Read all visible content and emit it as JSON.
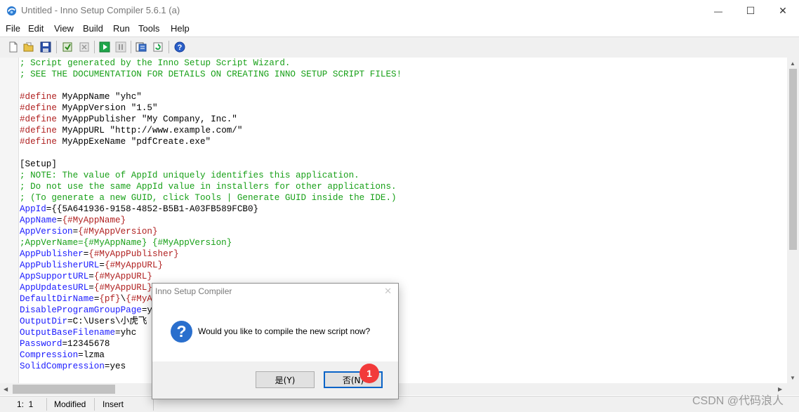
{
  "window": {
    "title": "Untitled - Inno Setup Compiler 5.6.1 (a)",
    "minimize_glyph": "—",
    "maximize_glyph": "☐",
    "close_glyph": "✕"
  },
  "menu": {
    "file": "File",
    "edit": "Edit",
    "view": "View",
    "build": "Build",
    "run": "Run",
    "tools": "Tools",
    "help": "Help"
  },
  "toolbar": {
    "icons": [
      "new-file-icon",
      "open-folder-icon",
      "save-icon",
      "compile-icon",
      "stop-compile-icon",
      "run-icon",
      "pause-icon",
      "target-icon",
      "refresh-icon",
      "help-icon"
    ]
  },
  "editor": {
    "lines": [
      {
        "segments": [
          {
            "text": "; Script generated by the Inno Setup Script Wizard.",
            "cls": "c-comment"
          }
        ]
      },
      {
        "segments": [
          {
            "text": "; SEE THE DOCUMENTATION FOR DETAILS ON CREATING INNO SETUP SCRIPT FILES!",
            "cls": "c-comment"
          }
        ]
      },
      {
        "segments": []
      },
      {
        "segments": [
          {
            "text": "#define",
            "cls": "c-define"
          },
          {
            "text": " MyAppName \"yhc\"",
            "cls": ""
          }
        ]
      },
      {
        "segments": [
          {
            "text": "#define",
            "cls": "c-define"
          },
          {
            "text": " MyAppVersion \"1.5\"",
            "cls": ""
          }
        ]
      },
      {
        "segments": [
          {
            "text": "#define",
            "cls": "c-define"
          },
          {
            "text": " MyAppPublisher \"My Company, Inc.\"",
            "cls": ""
          }
        ]
      },
      {
        "segments": [
          {
            "text": "#define",
            "cls": "c-define"
          },
          {
            "text": " MyAppURL \"http://www.example.com/\"",
            "cls": ""
          }
        ]
      },
      {
        "segments": [
          {
            "text": "#define",
            "cls": "c-define"
          },
          {
            "text": " MyAppExeName \"pdfCreate.exe\"",
            "cls": ""
          }
        ]
      },
      {
        "segments": []
      },
      {
        "segments": [
          {
            "text": "[Setup]",
            "cls": ""
          }
        ]
      },
      {
        "segments": [
          {
            "text": "; NOTE: The value of AppId uniquely identifies this application.",
            "cls": "c-comment"
          }
        ]
      },
      {
        "segments": [
          {
            "text": "; Do not use the same AppId value in installers for other applications.",
            "cls": "c-comment"
          }
        ]
      },
      {
        "segments": [
          {
            "text": "; (To generate a new GUID, click Tools | Generate GUID inside the IDE.)",
            "cls": "c-comment"
          }
        ]
      },
      {
        "segments": [
          {
            "text": "AppId",
            "cls": "c-key"
          },
          {
            "text": "={{5A641936-9158-4852-B5B1-A03FB589FCB0}",
            "cls": ""
          }
        ]
      },
      {
        "segments": [
          {
            "text": "AppName",
            "cls": "c-key"
          },
          {
            "text": "=",
            "cls": ""
          },
          {
            "text": "{#MyAppName}",
            "cls": "c-expr"
          }
        ]
      },
      {
        "segments": [
          {
            "text": "AppVersion",
            "cls": "c-key"
          },
          {
            "text": "=",
            "cls": ""
          },
          {
            "text": "{#MyAppVersion}",
            "cls": "c-expr"
          }
        ]
      },
      {
        "segments": [
          {
            "text": ";AppVerName={#MyAppName} {#MyAppVersion}",
            "cls": "c-comment"
          }
        ]
      },
      {
        "segments": [
          {
            "text": "AppPublisher",
            "cls": "c-key"
          },
          {
            "text": "=",
            "cls": ""
          },
          {
            "text": "{#MyAppPublisher}",
            "cls": "c-expr"
          }
        ]
      },
      {
        "segments": [
          {
            "text": "AppPublisherURL",
            "cls": "c-key"
          },
          {
            "text": "=",
            "cls": ""
          },
          {
            "text": "{#MyAppURL}",
            "cls": "c-expr"
          }
        ]
      },
      {
        "segments": [
          {
            "text": "AppSupportURL",
            "cls": "c-key"
          },
          {
            "text": "=",
            "cls": ""
          },
          {
            "text": "{#MyAppURL}",
            "cls": "c-expr"
          }
        ]
      },
      {
        "segments": [
          {
            "text": "AppUpdatesURL",
            "cls": "c-key"
          },
          {
            "text": "=",
            "cls": ""
          },
          {
            "text": "{#MyAppURL}",
            "cls": "c-expr"
          }
        ]
      },
      {
        "segments": [
          {
            "text": "DefaultDirName",
            "cls": "c-key"
          },
          {
            "text": "=",
            "cls": ""
          },
          {
            "text": "{pf}",
            "cls": "c-expr"
          },
          {
            "text": "\\",
            "cls": ""
          },
          {
            "text": "{#MyAppName}",
            "cls": "c-expr"
          }
        ]
      },
      {
        "segments": [
          {
            "text": "DisableProgramGroupPage",
            "cls": "c-key"
          },
          {
            "text": "=yes",
            "cls": ""
          }
        ]
      },
      {
        "segments": [
          {
            "text": "OutputDir",
            "cls": "c-key"
          },
          {
            "text": "=C:\\Users\\小虎飞",
            "cls": ""
          }
        ]
      },
      {
        "segments": [
          {
            "text": "OutputBaseFilename",
            "cls": "c-key"
          },
          {
            "text": "=yhc",
            "cls": ""
          }
        ]
      },
      {
        "segments": [
          {
            "text": "Password",
            "cls": "c-key"
          },
          {
            "text": "=12345678",
            "cls": ""
          }
        ]
      },
      {
        "segments": [
          {
            "text": "Compression",
            "cls": "c-key"
          },
          {
            "text": "=lzma",
            "cls": ""
          }
        ]
      },
      {
        "segments": [
          {
            "text": "SolidCompression",
            "cls": "c-key"
          },
          {
            "text": "=yes",
            "cls": ""
          }
        ]
      }
    ]
  },
  "status": {
    "position": "1:  1",
    "modified": "Modified",
    "mode": "Insert"
  },
  "dialog": {
    "title": "Inno Setup Compiler",
    "close_glyph": "✕",
    "question_glyph": "?",
    "message": "Would you like to compile the new script now?",
    "yes_label": "是(Y)",
    "no_label": "否(N)",
    "badge": "1"
  },
  "watermark": "CSDN @代码浪人"
}
